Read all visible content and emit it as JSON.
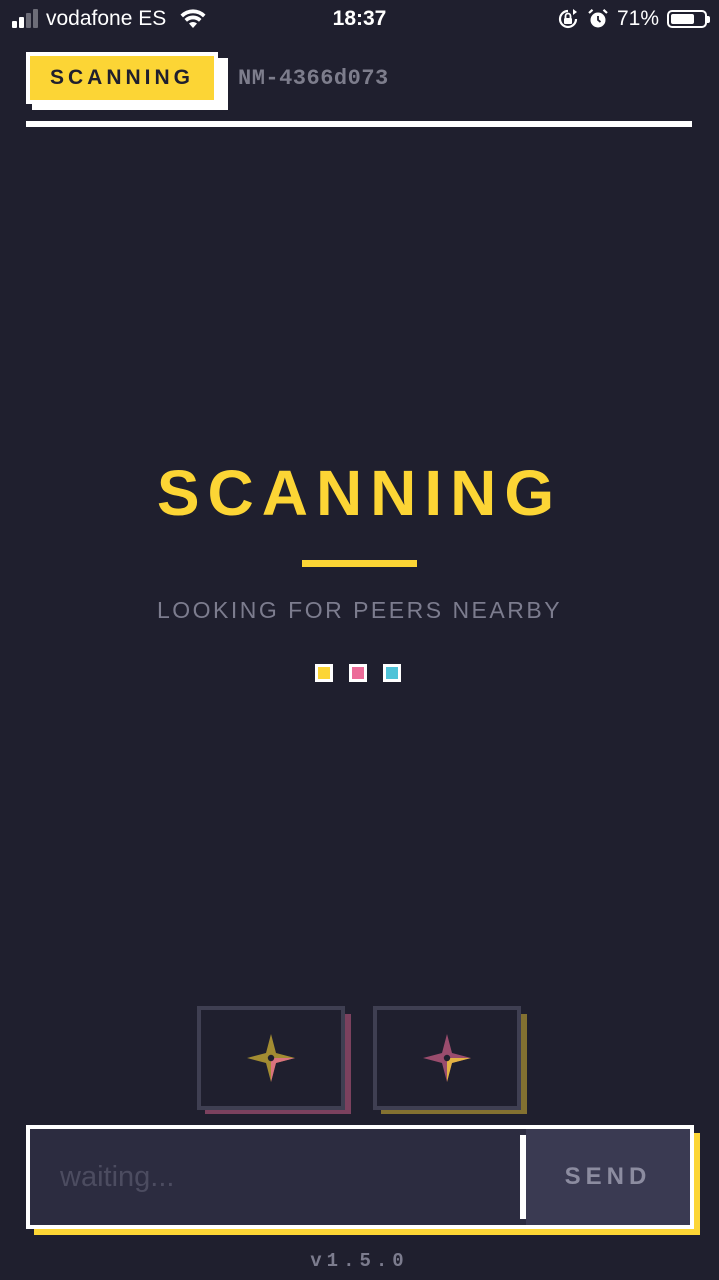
{
  "status_bar": {
    "carrier": "vodafone ES",
    "time": "18:37",
    "battery_percent": "71%",
    "battery_level": 0.71,
    "icons": [
      "signal-icon",
      "wifi-icon",
      "orientation-lock-icon",
      "alarm-icon",
      "battery-icon"
    ]
  },
  "header": {
    "status_badge": "SCANNING",
    "node_id": "NM-4366d073"
  },
  "main": {
    "title": "SCANNING",
    "subtitle": "LOOKING FOR PEERS NEARBY",
    "indicator_colors": [
      "#fcd535",
      "#ec6b98",
      "#4fc3d8"
    ]
  },
  "actions": [
    {
      "name": "star-button-1",
      "icon": "four-point-star-icon",
      "icon_color": "#fcd535",
      "shadow_color": "#ec6b98"
    },
    {
      "name": "star-button-2",
      "icon": "four-point-star-icon",
      "icon_color": "#ec6b98",
      "shadow_color": "#fcd535"
    }
  ],
  "composer": {
    "placeholder": "waiting...",
    "value": "",
    "send_label": "SEND"
  },
  "footer": {
    "version": "v1.5.0"
  },
  "colors": {
    "background": "#1f1f2e",
    "accent": "#fcd535",
    "pink": "#ec6b98",
    "cyan": "#4fc3d8",
    "muted_text": "#7c7c8e"
  }
}
